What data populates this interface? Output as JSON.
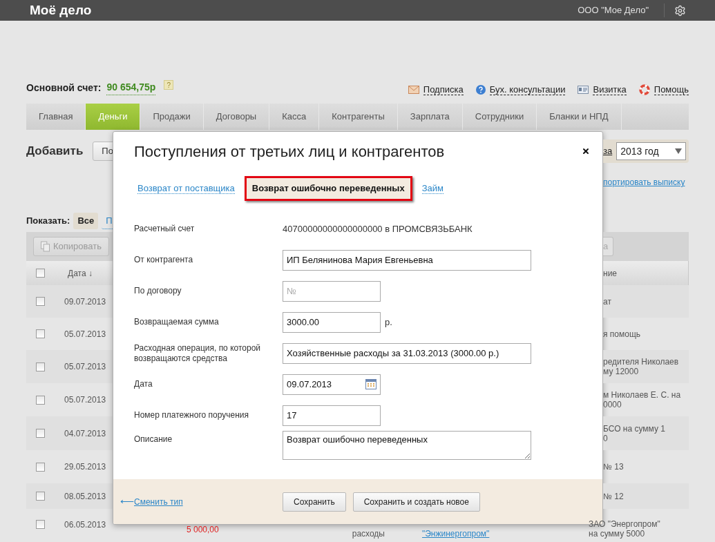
{
  "header": {
    "logo": "Моё дело",
    "company": "ООО \"Мое Дело\""
  },
  "account": {
    "label": "Основной счет:",
    "amount": "90 654,75р",
    "help": "?"
  },
  "top_links": [
    {
      "label": "Подписка",
      "kind": "mail"
    },
    {
      "label": "Бух. консультации",
      "kind": "question"
    },
    {
      "label": "Визитка",
      "kind": "card"
    },
    {
      "label": "Помощь",
      "kind": "lifebuoy"
    }
  ],
  "nav_tabs": [
    {
      "label": "Главная",
      "selected": false
    },
    {
      "label": "Деньги",
      "selected": true
    },
    {
      "label": "Продажи",
      "selected": false
    },
    {
      "label": "Договоры",
      "selected": false
    },
    {
      "label": "Касса",
      "selected": false
    },
    {
      "label": "Контрагенты",
      "selected": false
    },
    {
      "label": "Зарплата",
      "selected": false
    },
    {
      "label": "Сотрудники",
      "selected": false
    },
    {
      "label": "Бланки и НПД",
      "selected": false
    }
  ],
  "left_panel": {
    "add_label": "Добавить",
    "add_button": "По",
    "show_label": "Показать:",
    "filters": [
      {
        "label": "Все",
        "selected": true
      },
      {
        "label": "П",
        "selected": false
      }
    ],
    "copy_button": "Копировать"
  },
  "right_panel": {
    "period_link": "за",
    "year_select": "2013 год",
    "import_link": "портировать выписку",
    "toolbar_button": "а"
  },
  "table": {
    "header_checked": false,
    "columns": [
      "Дата ↓",
      "ние"
    ],
    "rows": [
      {
        "date": "09.07.2013",
        "checked": false,
        "description": [
          "ат"
        ]
      },
      {
        "date": "05.07.2013",
        "checked": false,
        "description": [
          "я помощь"
        ]
      },
      {
        "date": "05.07.2013",
        "checked": false,
        "description": [
          "редителя Николаев",
          "му 12000"
        ]
      },
      {
        "date": "05.07.2013",
        "checked": false,
        "description": [
          "м Николаев Е. С. на",
          "0000"
        ]
      },
      {
        "date": "04.07.2013",
        "checked": false,
        "description": [
          "БСО на сумму 1",
          "0"
        ]
      },
      {
        "date": "29.05.2013",
        "checked": false,
        "description": [
          "№ 13"
        ]
      },
      {
        "date": "08.05.2013",
        "checked": false,
        "description": [
          "№ 12"
        ]
      },
      {
        "date": "06.05.2013",
        "checked": false,
        "description": [
          "ЗАО \"Энергопром\"",
          "на сумму 5000"
        ],
        "amount": "5 000,00",
        "type": "расходы",
        "contractor": "\"Энжинергопром\""
      }
    ]
  },
  "modal": {
    "title": "Поступления от третьих лиц и контрагентов",
    "tabs": [
      {
        "label": "Возврат от поставщика",
        "selected": false
      },
      {
        "label": "Возврат ошибочно переведенных",
        "selected": true
      },
      {
        "label": "Займ",
        "selected": false
      }
    ],
    "fields": [
      {
        "kind": "static",
        "label": "Расчетный счет",
        "value": "40700000000000000000 в ПРОМСВЯЗЬБАНК"
      },
      {
        "kind": "wide",
        "label": "От контрагента",
        "value": "ИП Белянинова Мария Евгеньевна"
      },
      {
        "kind": "short",
        "label": "По договору",
        "placeholder": "№"
      },
      {
        "kind": "short",
        "label": "Возвращаемая сумма",
        "value": "3000.00",
        "suffix": "р."
      },
      {
        "kind": "wide",
        "label": "Расходная операция, по которой возвращаются средства",
        "value": "Хозяйственные расходы за 31.03.2013 (3000.00 р.)"
      },
      {
        "kind": "date",
        "label": "Дата",
        "value": "09.07.2013"
      },
      {
        "kind": "short",
        "label": "Номер платежного поручения",
        "value": "17"
      },
      {
        "kind": "textarea",
        "label": "Описание",
        "value": "Возврат ошибочно переведенных"
      }
    ],
    "back_arrow": "⟵",
    "back_link": "Сменить тип",
    "buttons": [
      "Сохранить",
      "Сохранить и создать новое"
    ]
  }
}
